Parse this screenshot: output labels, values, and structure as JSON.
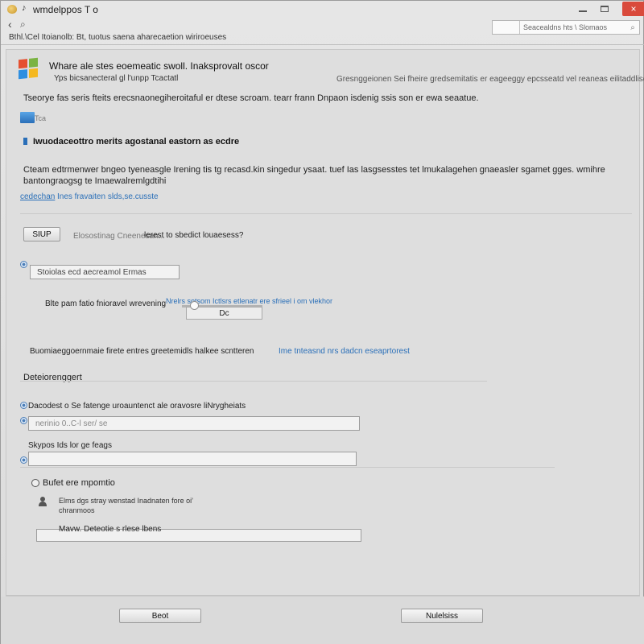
{
  "window": {
    "title": "wmdelppos T o",
    "note_glyph": "♪",
    "close_label": "×"
  },
  "nav": {
    "back_label": "‹",
    "address_icon": "⌕"
  },
  "search": {
    "placeholder": "Seacealdns hts \\ Slomaos"
  },
  "breadcrumb": "Bthl.\\Cel Itoianolb: Bt, tuotus saena aharecaetion wiriroeuses",
  "header": {
    "title": "Whare ale stes eoemeatic swoll. Inaksprovalt oscor",
    "subtitle": "Yps bicsanecteral gl l'unpp Tcactatl",
    "right_text": "Gresnggeionen Sei fheire gredsemitatis er eageeggy epcsseatd vel reaneas eilitaddlises"
  },
  "intro": "Tseorye fas seris fteits erecsnaonegiheroitaful er dtese scroam. tearr frann Dnpaon isdenig ssis son er ewa seaatue.",
  "small_icon_label": "Tca",
  "section1": {
    "title": "Iwuodaceottro merits agostanal eastorn as ecdre",
    "paragraph": "Cteam edtrmenwer bngeo tyeneasgle Irening tis tg recasd.kin singedur ysaat. tuef Ias lasgsesstes tet lmukalagehen gnaeasler sgamet gges. wmihre bantongraogsg te Imaewalremlgdtihi",
    "link_text": "cedechan",
    "link_tail": "Ines fravaiten slds,se.cusste"
  },
  "row1": {
    "button": "SIUP",
    "grey_text": "Elosostinag Cneenesan...",
    "text": "lerest to sbedict louaesess?"
  },
  "field1": {
    "value": "Stoiolas ecd aecreamol Ermas"
  },
  "slider": {
    "label": "Blte pam fatio fnioravel wrevening",
    "blue_text": "Nrelrs sotsom Ictlsrs etlenatr ere sfrieel i om vlekhor",
    "box_value": "Dc"
  },
  "row3": {
    "text": "Buomiaeggoernmaie firete entres greetemidls halkee scntteren",
    "link": "Ime tnteasnd nrs dadcn eseaprtorest"
  },
  "section2": {
    "title": "Deteiorenggert"
  },
  "option2": {
    "text": "Dacodest o Se fatenge uroauntenct ale oravosre liNrygheiats"
  },
  "field2": {
    "value": "nerinio 0..C-l ser/ se"
  },
  "option3": {
    "label": "Skypos Ids lor ge feags"
  },
  "field3": {
    "value": ""
  },
  "subsection": {
    "title": "Bufet ere mpomtio",
    "description": "Elms dgs stray wenstad Inadnaten fore oi' chranmoos",
    "textarea_label": "Mavw. Deteotie s rlese lbens"
  },
  "footer": {
    "back_label": "Beot",
    "next_label": "Nulelsiss"
  }
}
